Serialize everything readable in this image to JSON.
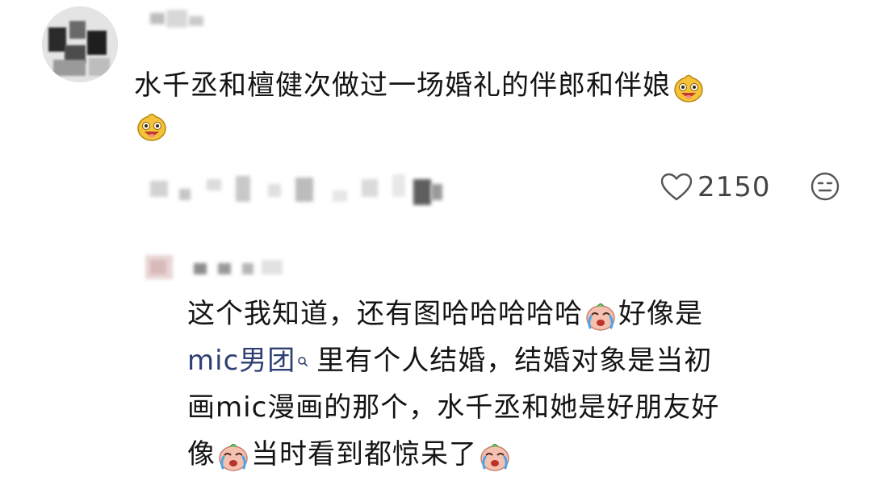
{
  "comment": {
    "text": "水千丞和檀健次做过一场婚礼的伴郎和伴娘",
    "like_count": "2150",
    "icons": {
      "like": "heart-outline-icon",
      "reaction": "meh-face-icon",
      "emoji": "grinning-bun-emoji"
    }
  },
  "reply": {
    "line1_text": "这个我知道，还有图哈哈哈哈哈",
    "line1_tail": "好像是",
    "link_text": "mic男团",
    "line2_tail": "里有个人结婚，结婚对象是当初",
    "line3": "画mic漫画的那个，水千丞和她是好朋友好",
    "line4_head": "像",
    "line4_text": "当时看到都惊呆了",
    "icons": {
      "emoji": "crying-bun-emoji",
      "link": "search-icon"
    }
  }
}
